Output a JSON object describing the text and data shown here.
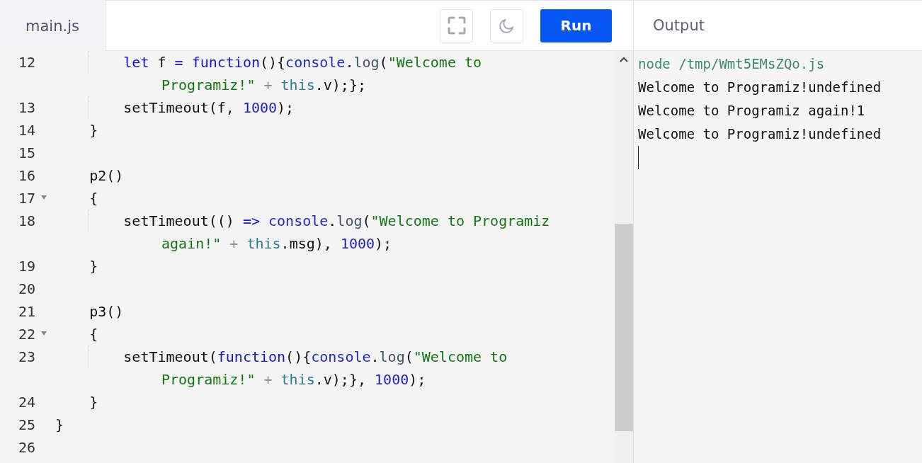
{
  "editor": {
    "tab": {
      "label": "main.js",
      "selected": true
    },
    "lines": [
      {
        "number": "12",
        "fold": false,
        "rows": [
          {
            "tokens": [
              {
                "text": "        let",
                "kind": "keyword"
              },
              {
                "text": " f ",
                "kind": "plain"
              },
              {
                "text": "= ",
                "kind": "keyword"
              },
              {
                "text": "function",
                "kind": "keyword"
              },
              {
                "text": "(){",
                "kind": "plain"
              },
              {
                "text": "console",
                "kind": "builtin"
              },
              {
                "text": ".",
                "kind": "plain"
              },
              {
                "text": "log",
                "kind": "method"
              },
              {
                "text": "(",
                "kind": "plain"
              },
              {
                "text": "\"Welcome to",
                "kind": "string"
              }
            ]
          },
          {
            "tokens": [
              {
                "text": "Programiz!\"",
                "kind": "string"
              },
              {
                "text": " + ",
                "kind": "operator"
              },
              {
                "text": "this",
                "kind": "this"
              },
              {
                "text": ".v);};",
                "kind": "plain"
              }
            ]
          }
        ]
      },
      {
        "number": "13",
        "fold": false,
        "rows": [
          {
            "tokens": [
              {
                "text": "        setTimeout(f, ",
                "kind": "plain"
              },
              {
                "text": "1000",
                "kind": "number"
              },
              {
                "text": ");",
                "kind": "plain"
              }
            ]
          }
        ]
      },
      {
        "number": "14",
        "fold": false,
        "rows": [
          {
            "tokens": [
              {
                "text": "    }",
                "kind": "plain"
              }
            ]
          }
        ]
      },
      {
        "number": "15",
        "fold": false,
        "rows": [
          {
            "tokens": []
          }
        ]
      },
      {
        "number": "16",
        "fold": false,
        "rows": [
          {
            "tokens": [
              {
                "text": "    p2()",
                "kind": "plain"
              }
            ]
          }
        ]
      },
      {
        "number": "17",
        "fold": true,
        "rows": [
          {
            "tokens": [
              {
                "text": "    {",
                "kind": "plain"
              }
            ]
          }
        ]
      },
      {
        "number": "18",
        "fold": false,
        "rows": [
          {
            "tokens": [
              {
                "text": "        setTimeout(() ",
                "kind": "plain"
              },
              {
                "text": "=> ",
                "kind": "keyword"
              },
              {
                "text": "console",
                "kind": "builtin"
              },
              {
                "text": ".",
                "kind": "plain"
              },
              {
                "text": "log",
                "kind": "method"
              },
              {
                "text": "(",
                "kind": "plain"
              },
              {
                "text": "\"Welcome to Programiz",
                "kind": "string"
              }
            ]
          },
          {
            "tokens": [
              {
                "text": "again!\"",
                "kind": "string"
              },
              {
                "text": " + ",
                "kind": "operator"
              },
              {
                "text": "this",
                "kind": "this"
              },
              {
                "text": ".msg), ",
                "kind": "plain"
              },
              {
                "text": "1000",
                "kind": "number"
              },
              {
                "text": ");",
                "kind": "plain"
              }
            ]
          }
        ]
      },
      {
        "number": "19",
        "fold": false,
        "rows": [
          {
            "tokens": [
              {
                "text": "    }",
                "kind": "plain"
              }
            ]
          }
        ]
      },
      {
        "number": "20",
        "fold": false,
        "rows": [
          {
            "tokens": []
          }
        ]
      },
      {
        "number": "21",
        "fold": false,
        "rows": [
          {
            "tokens": [
              {
                "text": "    p3()",
                "kind": "plain"
              }
            ]
          }
        ]
      },
      {
        "number": "22",
        "fold": true,
        "rows": [
          {
            "tokens": [
              {
                "text": "    {",
                "kind": "plain"
              }
            ]
          }
        ]
      },
      {
        "number": "23",
        "fold": false,
        "rows": [
          {
            "tokens": [
              {
                "text": "        setTimeout(",
                "kind": "plain"
              },
              {
                "text": "function",
                "kind": "keyword"
              },
              {
                "text": "(){",
                "kind": "plain"
              },
              {
                "text": "console",
                "kind": "builtin"
              },
              {
                "text": ".",
                "kind": "plain"
              },
              {
                "text": "log",
                "kind": "method"
              },
              {
                "text": "(",
                "kind": "plain"
              },
              {
                "text": "\"Welcome to",
                "kind": "string"
              }
            ]
          },
          {
            "tokens": [
              {
                "text": "Programiz!\"",
                "kind": "string"
              },
              {
                "text": " + ",
                "kind": "operator"
              },
              {
                "text": "this",
                "kind": "this"
              },
              {
                "text": ".v);}, ",
                "kind": "plain"
              },
              {
                "text": "1000",
                "kind": "number"
              },
              {
                "text": ");",
                "kind": "plain"
              }
            ]
          }
        ]
      },
      {
        "number": "24",
        "fold": false,
        "rows": [
          {
            "tokens": [
              {
                "text": "    }",
                "kind": "plain"
              }
            ]
          }
        ]
      },
      {
        "number": "25",
        "fold": false,
        "rows": [
          {
            "tokens": [
              {
                "text": "}",
                "kind": "plain"
              }
            ]
          }
        ]
      },
      {
        "number": "26",
        "fold": false,
        "rows": [
          {
            "tokens": []
          }
        ]
      }
    ]
  },
  "toolbar": {
    "run_button": "Run"
  },
  "output": {
    "title": "Output",
    "lines": [
      {
        "text": "node /tmp/Wmt5EMsZQo.js",
        "kind": "command"
      },
      {
        "text": "Welcome to Programiz!undefined",
        "kind": "text"
      },
      {
        "text": "Welcome to Programiz again!1",
        "kind": "text"
      },
      {
        "text": "Welcome to Programiz!undefined",
        "kind": "text"
      }
    ]
  }
}
